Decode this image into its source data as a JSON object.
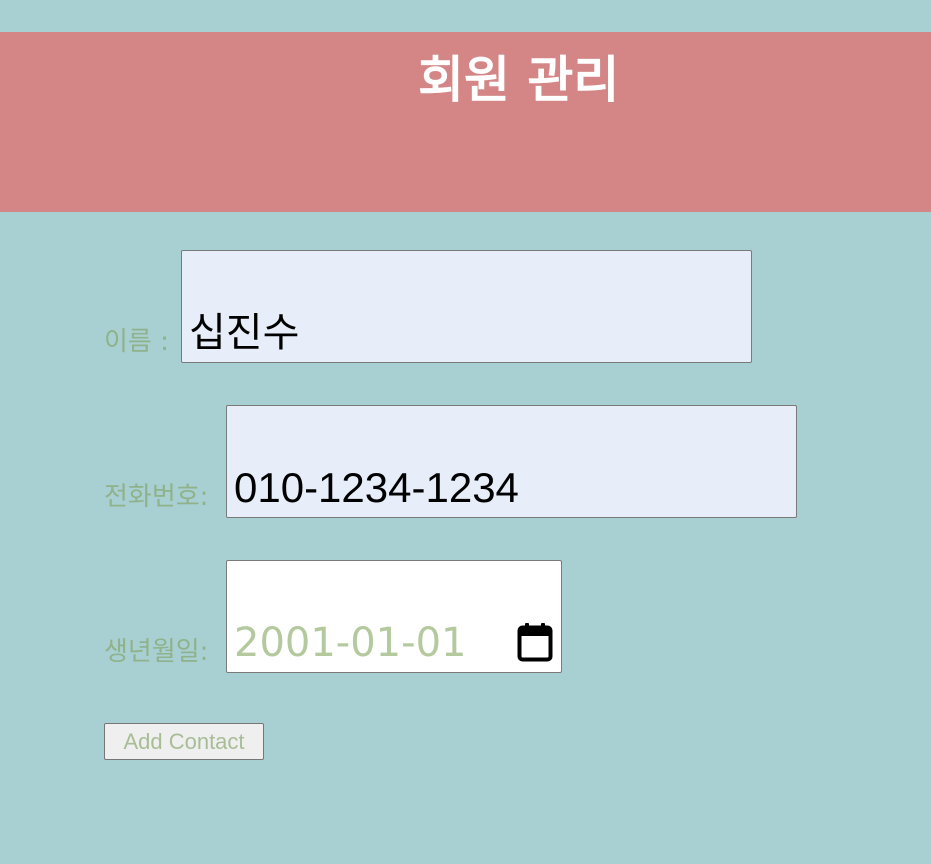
{
  "header": {
    "title": "회원 관리"
  },
  "form": {
    "name": {
      "label": "이름 :",
      "value": "십진수"
    },
    "phone": {
      "label": "전화번호:",
      "value": "010-1234-1234"
    },
    "birthdate": {
      "label": "생년월일:",
      "value": "2001-01-01",
      "icon": "calendar-icon"
    },
    "submit_label": "Add Contact"
  },
  "colors": {
    "page_background": "#a8d0d3",
    "header_background": "#d48686",
    "label_text": "#8fb28a",
    "input_background": "#e8eef9"
  }
}
